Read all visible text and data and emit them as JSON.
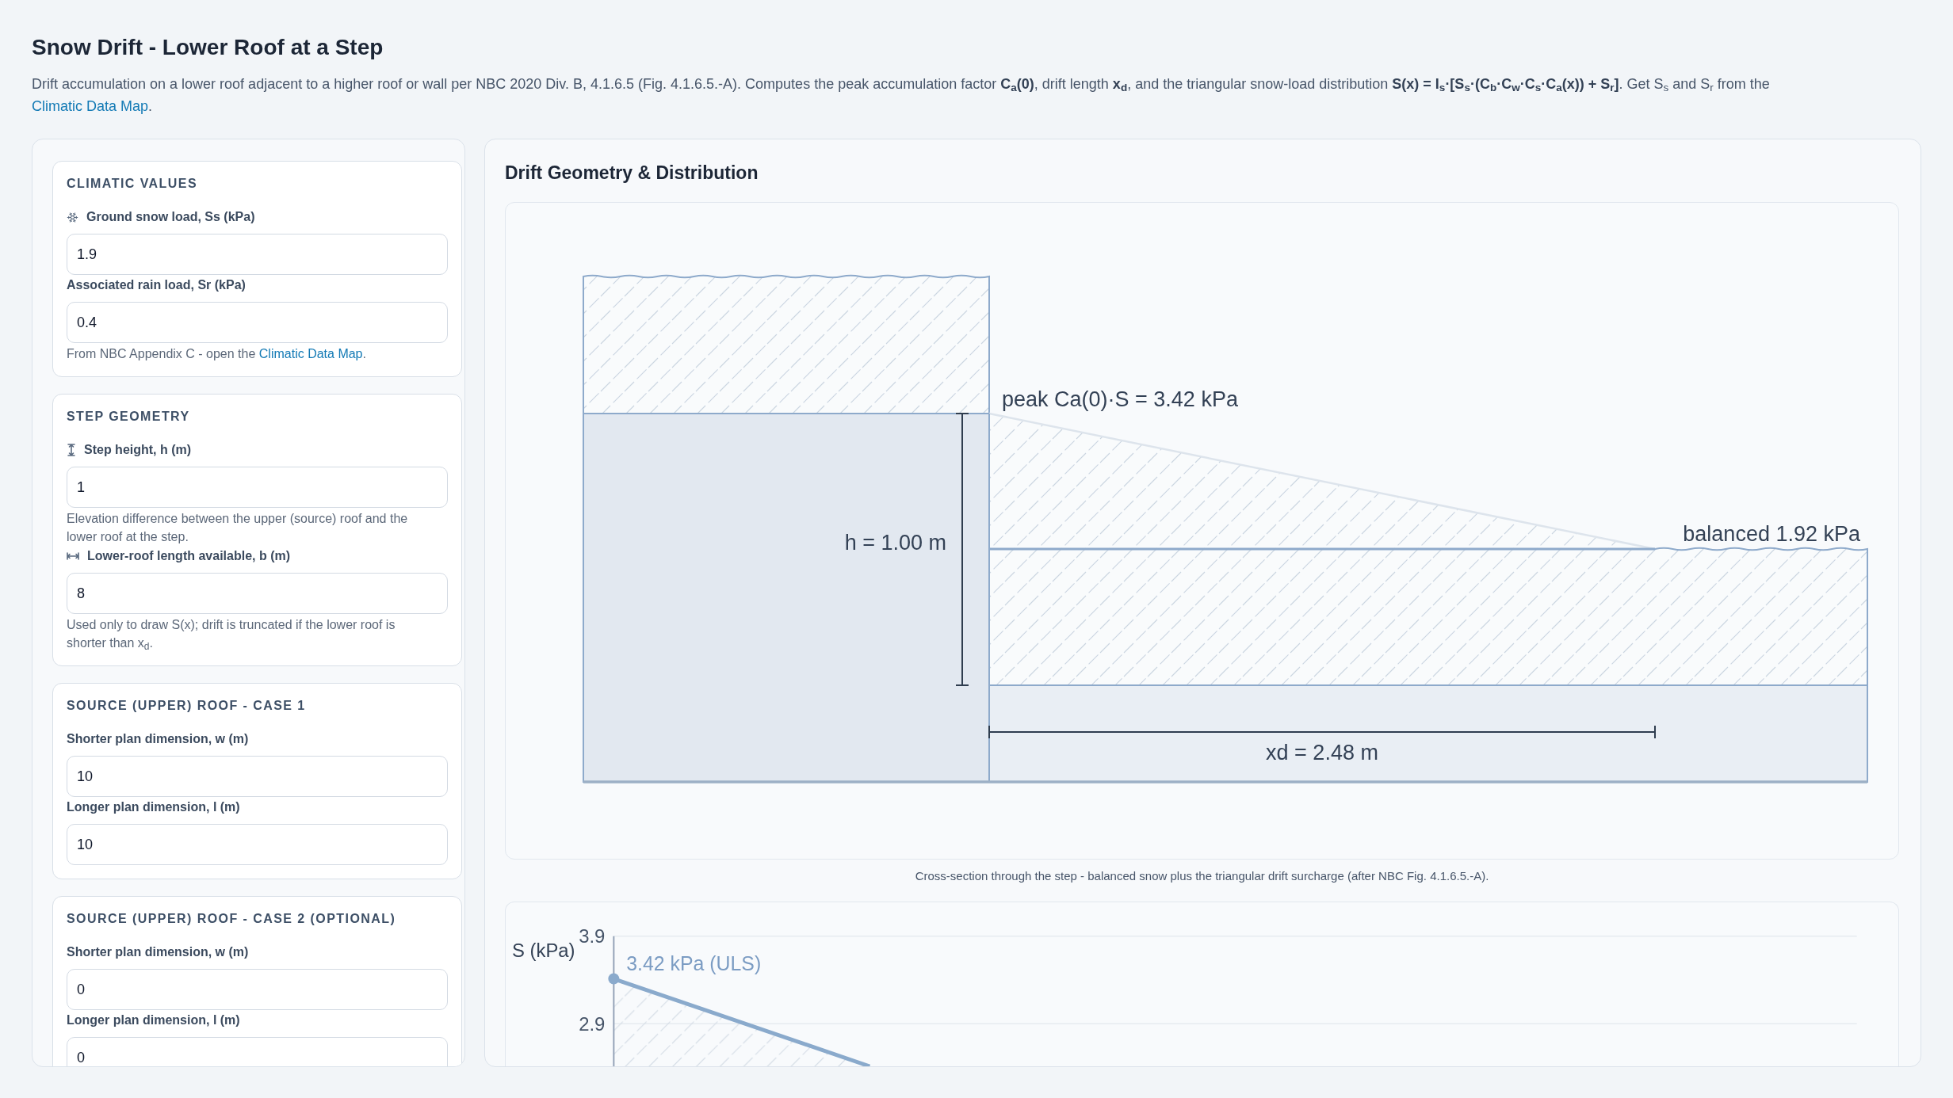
{
  "title": "Snow Drift - Lower Roof at a Step",
  "description": {
    "text": "Drift accumulation on a lower roof adjacent to a higher roof or wall per NBC 2020 Div. B, 4.1.6.5 (Fig. 4.1.6.5.-A). Computes the peak accumulation factor **C$_{a}$(0)**, drift length **x$_{d}$**, and the triangular snow-load distribution **S(x) = I$_{s}$·[S$_{s}$·(C$_{b}$·C$_{w}$·C$_{s}$·C$_{a}$(x)) + S$_{r}$]**. Get S$_{s}$ and S$_{r}$ from the",
    "link": "Climatic Data Map",
    "after": "."
  },
  "sections": [
    {
      "heading": "CLIMATIC VALUES",
      "fields": [
        {
          "kind": "snow",
          "label": "Ground snow load, Ss (kPa)",
          "value": "1.9"
        },
        {
          "kind": "plain",
          "label": "Associated rain load, Sr (kPa)",
          "value": "0.4",
          "note": {
            "text": "From NBC Appendix C - open the",
            "link": "Climatic Data Map",
            "after": "."
          }
        }
      ]
    },
    {
      "heading": "STEP GEOMETRY",
      "fields": [
        {
          "kind": "height",
          "label": "Step height, h (m)",
          "value": "1",
          "note": {
            "text": "Elevation difference between the upper (source) roof and the lower roof at the step."
          }
        },
        {
          "kind": "length",
          "label": "Lower-roof length available, b (m)",
          "value": "8",
          "note": {
            "text": "Used only to draw S(x); drift is truncated if the lower roof is shorter than x$_{d}$."
          }
        }
      ]
    },
    {
      "heading": "SOURCE (UPPER) ROOF - CASE 1",
      "fields": [
        {
          "kind": "plain",
          "label": "Shorter plan dimension, w (m)",
          "value": "10"
        },
        {
          "kind": "plain",
          "label": "Longer plan dimension, l (m)",
          "value": "10"
        }
      ]
    },
    {
      "heading": "SOURCE (UPPER) ROOF - CASE 2 (OPTIONAL)",
      "fields": [
        {
          "kind": "plain",
          "label": "Shorter plan dimension, w (m)",
          "value": "0"
        },
        {
          "kind": "plain",
          "label": "Longer plan dimension, l (m)",
          "value": "0"
        }
      ]
    }
  ],
  "results": {
    "heading": "Drift Geometry & Distribution",
    "diagram": {
      "peak_label": "peak Ca(0)·S = 3.42 kPa",
      "height_label": "h = 1.00 m",
      "balanced_label": "balanced 1.92 kPa",
      "drift_length_label": "xd = 2.48 m"
    },
    "caption": "Cross-section through the step - balanced snow plus the triangular drift surcharge (after NBC Fig. 4.1.6.5.-A).",
    "load_plot": {
      "axis_label": "S (kPa)",
      "tick_labels": [
        "3.9",
        "2.9"
      ],
      "peak_label": "3.42 kPa (ULS)"
    }
  }
}
